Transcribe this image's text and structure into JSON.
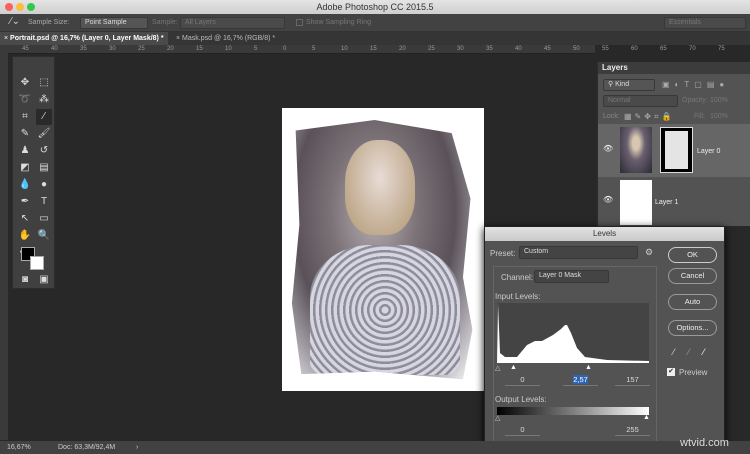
{
  "window": {
    "title": "Adobe Photoshop CC 2015.5"
  },
  "options_bar": {
    "sample_size_label": "Sample Size:",
    "sample_size_value": "Point Sample",
    "sample_label": "Sample:",
    "sample_value": "All Layers",
    "show_sampling_ring": "Show Sampling Ring",
    "workspace": "Essentials"
  },
  "tabs": [
    {
      "label": "Portrait.psd @ 16,7% (Layer 0, Layer Mask/8) *",
      "active": true
    },
    {
      "label": "Mask.psd @ 16,7% (RGB/8) *",
      "active": false
    }
  ],
  "ruler": [
    "45",
    "40",
    "35",
    "30",
    "25",
    "20",
    "15",
    "10",
    "5",
    "0",
    "5",
    "10",
    "15",
    "20",
    "25",
    "30",
    "35",
    "40",
    "45",
    "50",
    "55",
    "60",
    "65",
    "70",
    "75"
  ],
  "layers_panel": {
    "title": "Layers",
    "filter": "Kind",
    "blend_mode": "Normal",
    "opacity_label": "Opacity:",
    "opacity": "100%",
    "lock_label": "Lock:",
    "fill_label": "Fill:",
    "fill": "100%",
    "layers": [
      {
        "name": "Layer 0"
      },
      {
        "name": "Layer 1"
      }
    ]
  },
  "levels": {
    "title": "Levels",
    "preset_label": "Preset:",
    "preset": "Custom",
    "channel_label": "Channel:",
    "channel": "Layer 0 Mask",
    "input_label": "Input Levels:",
    "input_black": "0",
    "input_gamma": "2,57",
    "input_white": "157",
    "output_label": "Output Levels:",
    "output_black": "0",
    "output_white": "255",
    "ok": "OK",
    "cancel": "Cancel",
    "auto": "Auto",
    "options": "Options...",
    "preview": "Preview",
    "preview_checked": true
  },
  "status": {
    "zoom": "16,67%",
    "doc": "Doc: 63,3M/92,4M"
  },
  "watermark": "wtvid.com"
}
